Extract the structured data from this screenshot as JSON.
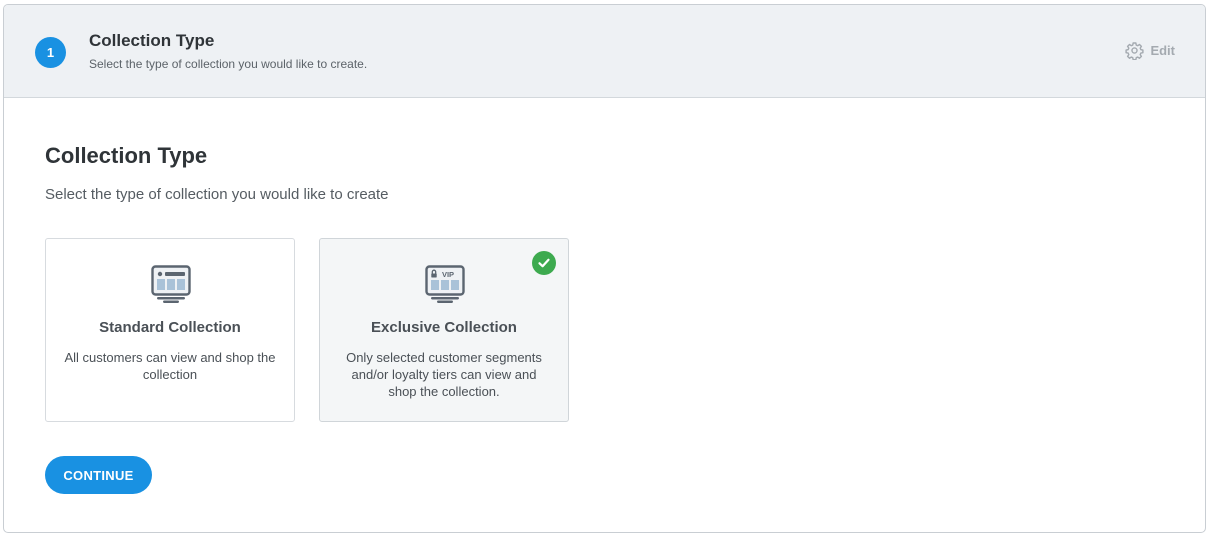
{
  "step": {
    "number": "1",
    "title": "Collection Type",
    "subtitle": "Select the type of collection you would like to create.",
    "edit_label": "Edit",
    "edit_icon": "gear-icon"
  },
  "content": {
    "title": "Collection Type",
    "subtitle": "Select the type of collection you would like to create"
  },
  "options": [
    {
      "icon": "storefront-icon",
      "title": "Standard Collection",
      "description": "All customers can view and shop the collection",
      "selected": false
    },
    {
      "icon": "vip-storefront-icon",
      "icon_text": "VIP",
      "title": "Exclusive Collection",
      "description": "Only selected customer segments and/or loyalty tiers can view and shop the collection.",
      "selected": true
    }
  ],
  "continue_label": "CONTINUE",
  "colors": {
    "accent": "#1991e2",
    "selected_check": "#3daa4f",
    "header_bg": "#eef1f4"
  }
}
